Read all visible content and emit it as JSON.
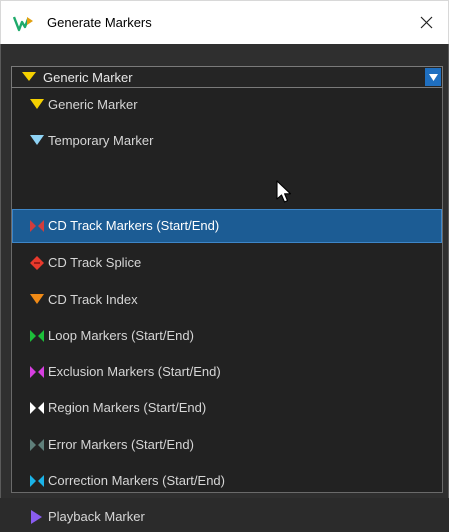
{
  "window": {
    "title": "Generate Markers",
    "close_glyph": "✕",
    "app_icon": "wavelab-logo-icon",
    "colors": {
      "accent": "#1c5c94",
      "dropdown_arrow_bg": "#1f6fc0"
    }
  },
  "marker_type_select": {
    "selected_value": "Generic Marker",
    "selected_icon": "generic-marker-icon",
    "selected_color": "#f4d000",
    "arrow_glyph": "▼"
  },
  "options": [
    {
      "label": "Generic Marker",
      "icon": "generic-marker-icon",
      "color": "#f4d000"
    },
    {
      "label": "Temporary Marker",
      "icon": "temporary-marker-icon",
      "color": "#8fd3f5"
    },
    {
      "label": "CD Track Markers (Start/End)",
      "icon": "cd-track-markers-icon",
      "color": "#d13d3d",
      "selected": true
    },
    {
      "label": "CD Track Splice",
      "icon": "cd-track-splice-icon",
      "color": "#e8392c"
    },
    {
      "label": "CD Track Index",
      "icon": "cd-track-index-icon",
      "color": "#f08a16"
    },
    {
      "label": "Loop Markers (Start/End)",
      "icon": "loop-markers-icon",
      "color": "#1dbf3a"
    },
    {
      "label": "Exclusion Markers (Start/End)",
      "icon": "exclusion-markers-icon",
      "color": "#d63fe0"
    },
    {
      "label": "Region Markers (Start/End)",
      "icon": "region-markers-icon",
      "color": "#ffffff"
    },
    {
      "label": "Error Markers (Start/End)",
      "icon": "error-markers-icon",
      "color": "#5f7f7a"
    },
    {
      "label": "Correction Markers (Start/End)",
      "icon": "correction-markers-icon",
      "color": "#1ab3e8"
    },
    {
      "label": "Playback Marker",
      "icon": "playback-marker-icon",
      "color": "#8a5cf0"
    }
  ]
}
